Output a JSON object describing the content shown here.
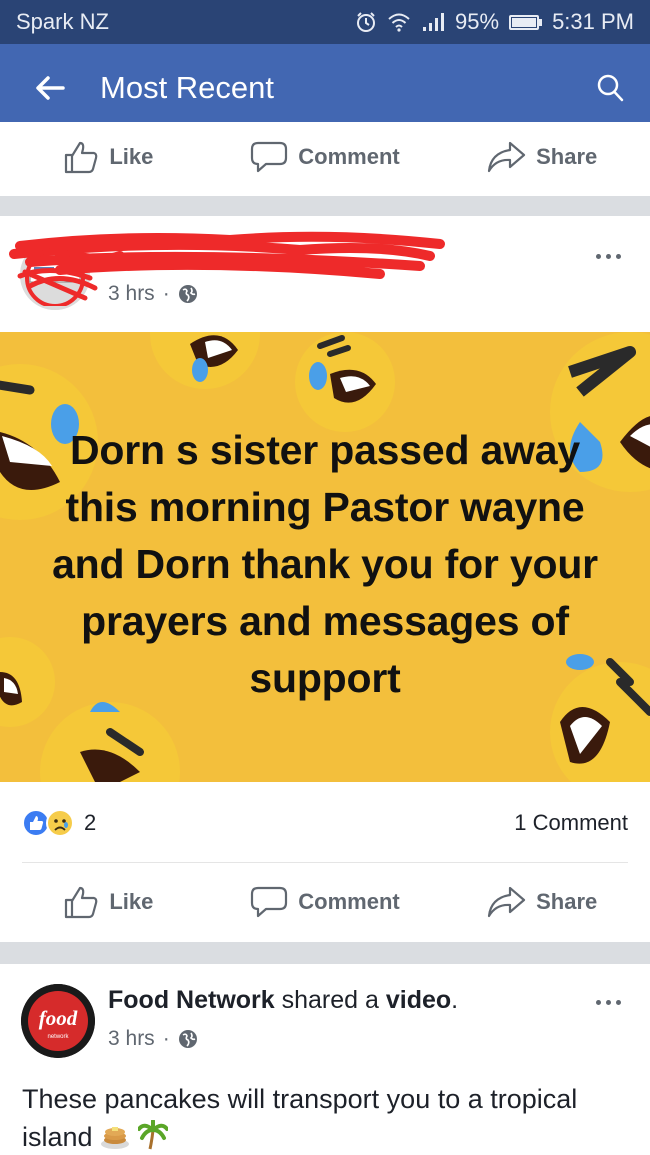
{
  "status_bar": {
    "carrier": "Spark NZ",
    "battery": "95%",
    "time": "5:31 PM",
    "icons": [
      "alarm-icon",
      "wifi-icon",
      "signal-icon",
      "battery-icon"
    ]
  },
  "app_bar": {
    "title": "Most Recent",
    "back_icon": "arrow-left-icon",
    "search_icon": "search-icon",
    "color": "#4267b2"
  },
  "actions": {
    "like": "Like",
    "comment": "Comment",
    "share": "Share"
  },
  "post1": {
    "time": "3 hrs",
    "separator": "·",
    "image_text": "Dorn s sister passed away this morning Pastor wayne and Dorn thank you for your prayers and messages of support",
    "image_bg": "#f3bf3c",
    "reaction_count": "2",
    "comment_count": "1 Comment"
  },
  "post2": {
    "page_name": "Food Network",
    "shared_text": "shared a",
    "object": "video",
    "period": ".",
    "time": "3 hrs",
    "separator": "·",
    "avatar_text": "food",
    "avatar_subtext": "network",
    "text": "These pancakes will transport you to a tropical island",
    "emojis": [
      "pancakes-emoji",
      "palm-tree-emoji"
    ]
  }
}
